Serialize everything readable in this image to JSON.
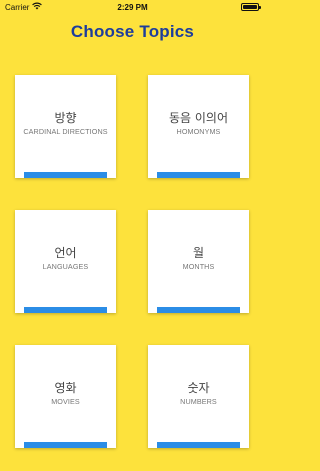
{
  "status_bar": {
    "carrier": "Carrier",
    "time": "2:29 PM"
  },
  "title": "Choose Topics",
  "topics": [
    {
      "korean": "방향",
      "english": "CARDINAL DIRECTIONS"
    },
    {
      "korean": "동음 이의어",
      "english": "HOMONYMS"
    },
    {
      "korean": "언어",
      "english": "LANGUAGES"
    },
    {
      "korean": "월",
      "english": "MONTHS"
    },
    {
      "korean": "영화",
      "english": "MOVIES"
    },
    {
      "korean": "숫자",
      "english": "NUMBERS"
    }
  ],
  "colors": {
    "background": "#fde23c",
    "title": "#1d3d9c",
    "card_accent": "#2b8de6"
  }
}
